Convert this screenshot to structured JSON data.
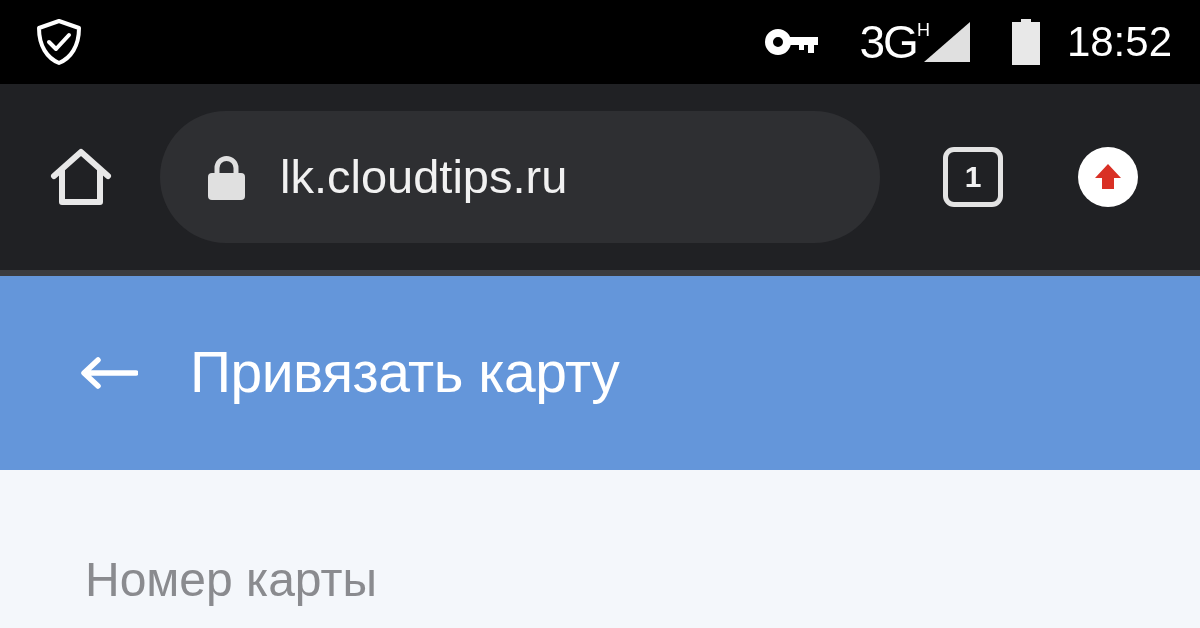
{
  "status_bar": {
    "network": "3G$^{H}$",
    "time": "18:52"
  },
  "browser_toolbar": {
    "url": "lk.cloudtips.ru",
    "tab_count": "1"
  },
  "app_bar": {
    "title": "Привязать карту"
  },
  "form": {
    "fields": [
      {
        "label": "Номер карты"
      }
    ]
  }
}
